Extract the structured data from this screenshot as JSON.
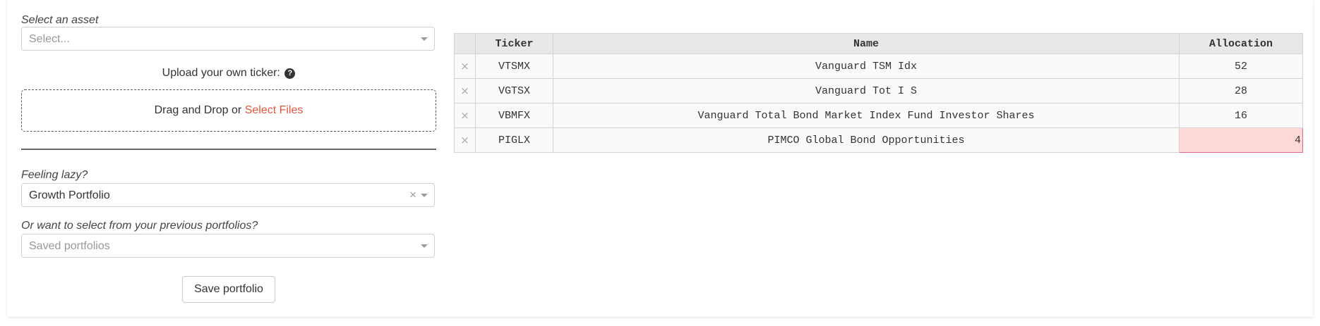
{
  "asset_select": {
    "label": "Select an asset",
    "placeholder": "Select..."
  },
  "upload": {
    "label": "Upload your own ticker:",
    "help_icon": "question-circle-icon",
    "dropzone_text": "Drag and Drop or",
    "dropzone_link": "Select Files"
  },
  "lazy": {
    "label": "Feeling lazy?",
    "value": "Growth Portfolio"
  },
  "previous": {
    "label": "Or want to select from your previous portfolios?",
    "placeholder": "Saved portfolios"
  },
  "save_button": "Save portfolio",
  "table": {
    "columns": [
      "Ticker",
      "Name",
      "Allocation"
    ],
    "rows": [
      {
        "ticker": "VTSMX",
        "name": "Vanguard TSM Idx",
        "allocation": "52"
      },
      {
        "ticker": "VGTSX",
        "name": "Vanguard Tot I S",
        "allocation": "28"
      },
      {
        "ticker": "VBMFX",
        "name": "Vanguard Total Bond Market Index Fund Investor Shares",
        "allocation": "16"
      },
      {
        "ticker": "PIGLX",
        "name": "PIMCO Global Bond Opportunities",
        "allocation": "4"
      }
    ],
    "delete_glyph": "×"
  },
  "colors": {
    "link": "#e8543c",
    "error_cell_bg": "#ffd8d8",
    "error_cell_border": "#e06a8a",
    "header_bg": "#e8e8e8"
  }
}
